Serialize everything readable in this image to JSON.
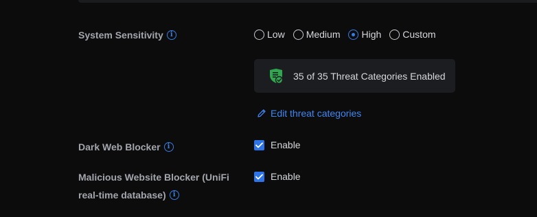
{
  "sensitivity": {
    "label": "System Sensitivity",
    "info_icon": "i",
    "options": [
      "Low",
      "Medium",
      "High",
      "Custom"
    ],
    "selected": "High"
  },
  "threat_summary": {
    "text": "35 of 35 Threat Categories Enabled",
    "icon": "shield-check-icon",
    "icon_color": "#2fa84f"
  },
  "edit_link": {
    "label": "Edit threat categories",
    "icon": "pencil-icon"
  },
  "dark_web_blocker": {
    "label": "Dark Web Blocker",
    "checkbox_label": "Enable",
    "checked": true
  },
  "malicious_blocker": {
    "label_line1": "Malicious Website Blocker (UniFi",
    "label_line2": "real-time database)",
    "checkbox_label": "Enable",
    "checked": true
  },
  "colors": {
    "accent": "#3a7be0",
    "background": "#0c0c0d",
    "panel": "#1c1d20"
  }
}
